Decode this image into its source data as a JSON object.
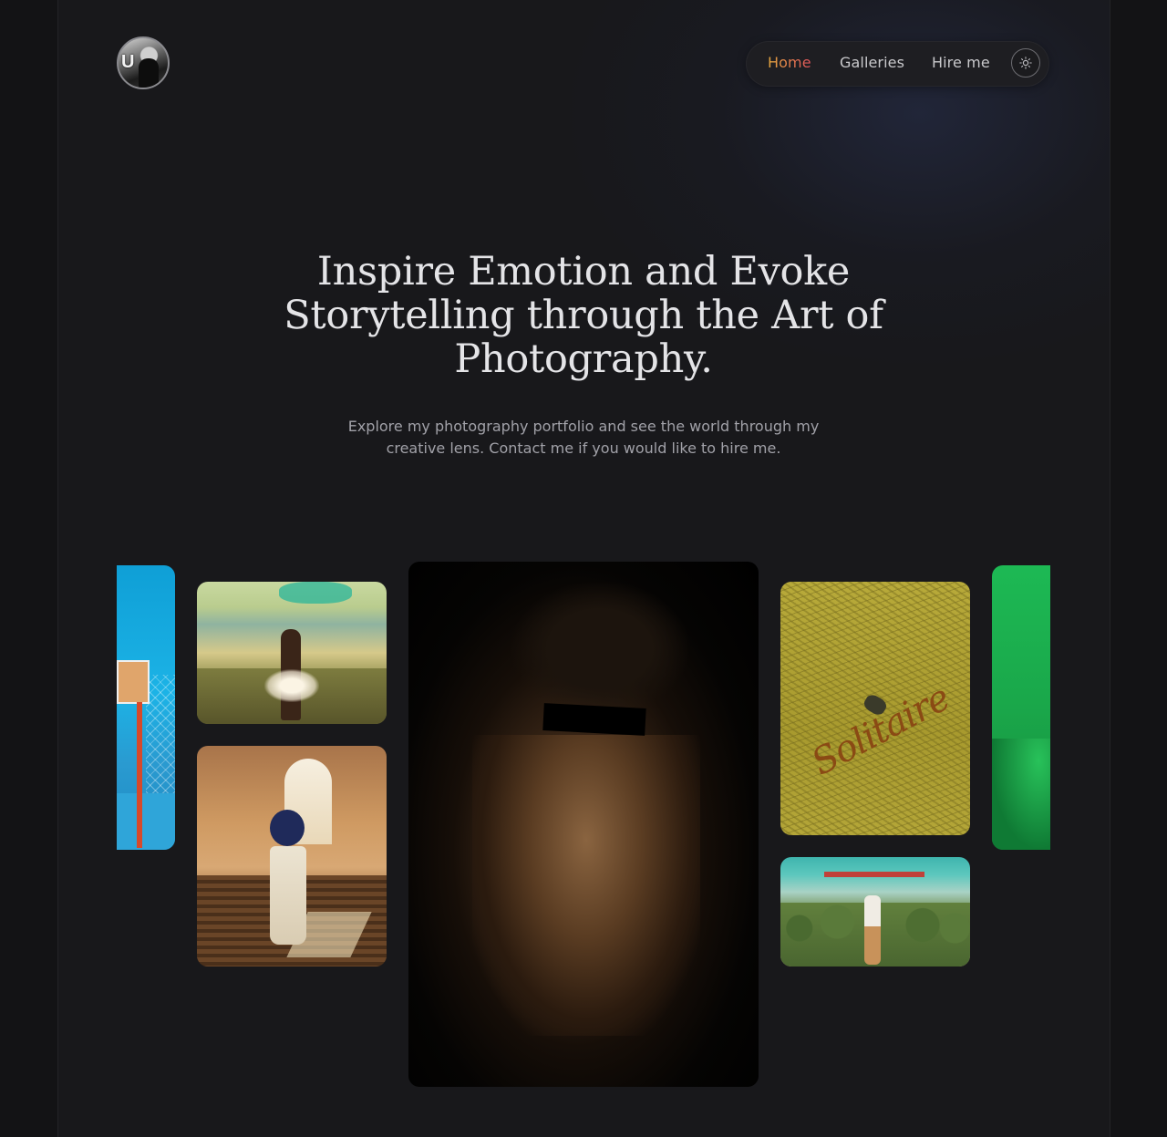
{
  "nav": {
    "items": [
      {
        "label": "Home",
        "active": true
      },
      {
        "label": "Galleries",
        "active": false
      },
      {
        "label": "Hire me",
        "active": false
      }
    ],
    "theme_toggle_icon": "sun-icon"
  },
  "avatar": {
    "monogram": "U"
  },
  "hero": {
    "title": "Inspire Emotion and Evoke Storytelling through the Art of Photography.",
    "subtitle": "Explore my photography portfolio and see the world through my creative lens. Contact me if you would like to hire me."
  },
  "gallery": {
    "photos": [
      {
        "subject": "basketball-court"
      },
      {
        "subject": "man-in-field-with-cloud"
      },
      {
        "subject": "child-by-window"
      },
      {
        "subject": "portrait-censored-eyes"
      },
      {
        "subject": "solitaire-field",
        "text": "Solitaire"
      },
      {
        "subject": "woman-in-field"
      },
      {
        "subject": "green-jacket"
      }
    ]
  },
  "colors": {
    "background": "#18181b",
    "accent_start": "#e3a63d",
    "accent_end": "#e0525c",
    "nav_text": "#c9c9cc"
  }
}
